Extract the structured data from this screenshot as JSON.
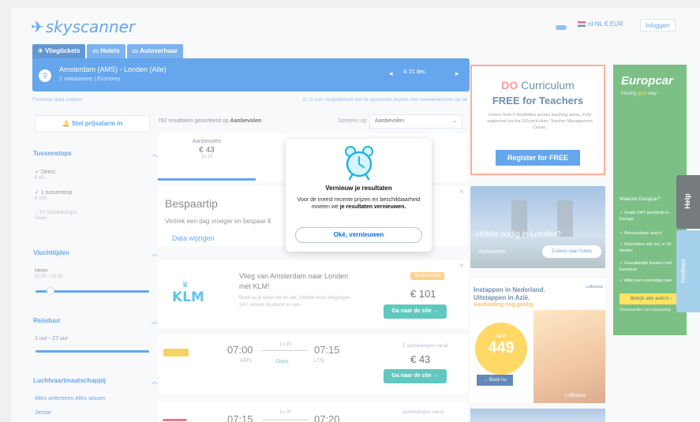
{
  "header": {
    "logo": "skyscanner",
    "locale": "nl-NL € EUR",
    "login": "Inloggen"
  },
  "tabs": [
    "Vliegtickets",
    "Hotels",
    "Autoverhuur"
  ],
  "search": {
    "route": "Amsterdam (AMS) - Londen (Alle)",
    "sub": "1 volwassene  |  Economy",
    "date": "ik 21 dec."
  },
  "helper_left": "Flexibele data zoeken",
  "helper_right": "Er is een mogelijkheid dat de getoonde prijzen niet overeenkomen op de website",
  "sidebar": {
    "alert": "Stel prijsalarm in",
    "stops_title": "Tussenstops",
    "stops": [
      {
        "label": "Direct",
        "price": "€ 43"
      },
      {
        "label": "1 tussenstop",
        "price": "€ 100"
      },
      {
        "label": "2+ tussenstops",
        "price": "Geen"
      }
    ],
    "times_title": "Vluchttijden",
    "times_label": "Heen",
    "times_value": "00:00 - 23:59",
    "duration_title": "Reisduur",
    "duration_value": "1 uur - 27 uur",
    "airlines_title": "Luchtvaartmaatschappij",
    "airlines_links": "Alles selecteren   Alles wissen",
    "airline_first": "Jetstar"
  },
  "results": {
    "count_prefix": "762 resultaten gesorteerd op",
    "count_bold": "Aanbevolen",
    "sort_label": "Sorteren op",
    "sort_value": "Aanbevolen",
    "best_label": "Aanbevolen",
    "best_price": "€ 43",
    "best_duration": "1u 15"
  },
  "tip": {
    "title": "Bespaartip",
    "text": "Vertrek een dag vroeger en bespaar €",
    "link": "Data wijzigen"
  },
  "ad_result": {
    "airline": "KLM",
    "title": "Vlieg van Amsterdam naar Londen met KLM!",
    "desc": "Boek nu je ticket via de site. Ontdek onze vliegtuigen. 24/7 service bij vlucht en reis.",
    "badge": "Gesponsord",
    "price": "€ 101",
    "cta": "Ga naar de site →"
  },
  "flights": [
    {
      "dep": "07:00",
      "arr": "07:15",
      "from": "AMS",
      "to": "LTN",
      "dur": "1u 15",
      "stops": "Direct",
      "deal": "5 aanbiedingen vanaf",
      "price": "€ 43",
      "cta": "Ga naar de site →"
    },
    {
      "dep": "07:15",
      "arr": "07:20",
      "dur": "1u 05",
      "deal": "aanbiedingen vanaf"
    }
  ],
  "ads": {
    "curriculum_title": "Curriculum",
    "curriculum_mark": "DO",
    "curriculum_sub": "FREE for Teachers",
    "curriculum_text": "Unison from 5 flexibilities across teaching areas. Fully supported via the DOcurriculum. Teacher Management Center.",
    "curriculum_btn": "Register for FREE",
    "london_title": "Hotels nodig in Londen?",
    "london_brand": "skyscanner",
    "london_btn": "Zoeken naar hotels",
    "asia_title": "Instappen in Nederland. Uitstappen in Azië.",
    "asia_offer": "Aanbieding nog geldig",
    "asia_logo": "Lufthansa",
    "asia_from": "Azië",
    "asia_price": "449",
    "asia_book": "→ Book nu",
    "asia_brand": "Lufthansa",
    "europcar_logo": "Europcar",
    "europcar_slogan_a": "Moving",
    "europcar_slogan_b": "your",
    "europcar_slogan_c": "way",
    "europcar_q": "Waarom Europcar?",
    "europcar_points": [
      "Gratis 24/7 pechhulp in Europa",
      "Betrouwbare auto's",
      "Kilometers zijn vrij, in 15 landen",
      "Gemakkelijk boeken met Europcar",
      "Altijd een voordelige rate"
    ],
    "europcar_cta": "Bekijk alle auto's ›",
    "europcar_small": "Voorwaarden van toepassing"
  },
  "help": "Help",
  "feedback": "Feedback",
  "modal": {
    "title": "Vernieuw je resultaten",
    "msg_a": "Voor de meest recente prijzen en beschikbaarheid moeten we",
    "msg_b": "je resultaten vernieuwen.",
    "ok": "Oké, vernieuwen"
  }
}
